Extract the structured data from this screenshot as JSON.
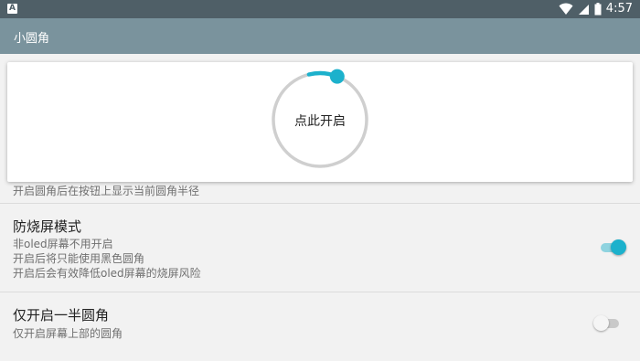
{
  "status_bar": {
    "notification_glyph": "A",
    "time": "4:57",
    "icons": [
      "wifi-icon",
      "cell-signal-icon",
      "battery-icon"
    ]
  },
  "toolbar": {
    "title": "小圆角"
  },
  "settings": {
    "radius_row": {
      "subtitle": "开启圆角后在按钮上显示当前圆角半径"
    },
    "burn_in": {
      "title": "防烧屏模式",
      "lines": [
        "非oled屏幕不用开启",
        "开启后将只能使用黑色圆角",
        "开启后会有效降低oled屏幕的烧屏风险"
      ],
      "enabled": true
    },
    "half_corners": {
      "title": "仅开启一半圆角",
      "subtitle": "仅开启屏幕上部的圆角",
      "enabled": false
    }
  },
  "dialog": {
    "button_label": "点此开启",
    "progress_fraction": 0.06
  },
  "colors": {
    "status_bar": "#4f5f67",
    "toolbar": "#7a939d",
    "accent": "#1cb1cc",
    "background": "#f2f2f2"
  }
}
